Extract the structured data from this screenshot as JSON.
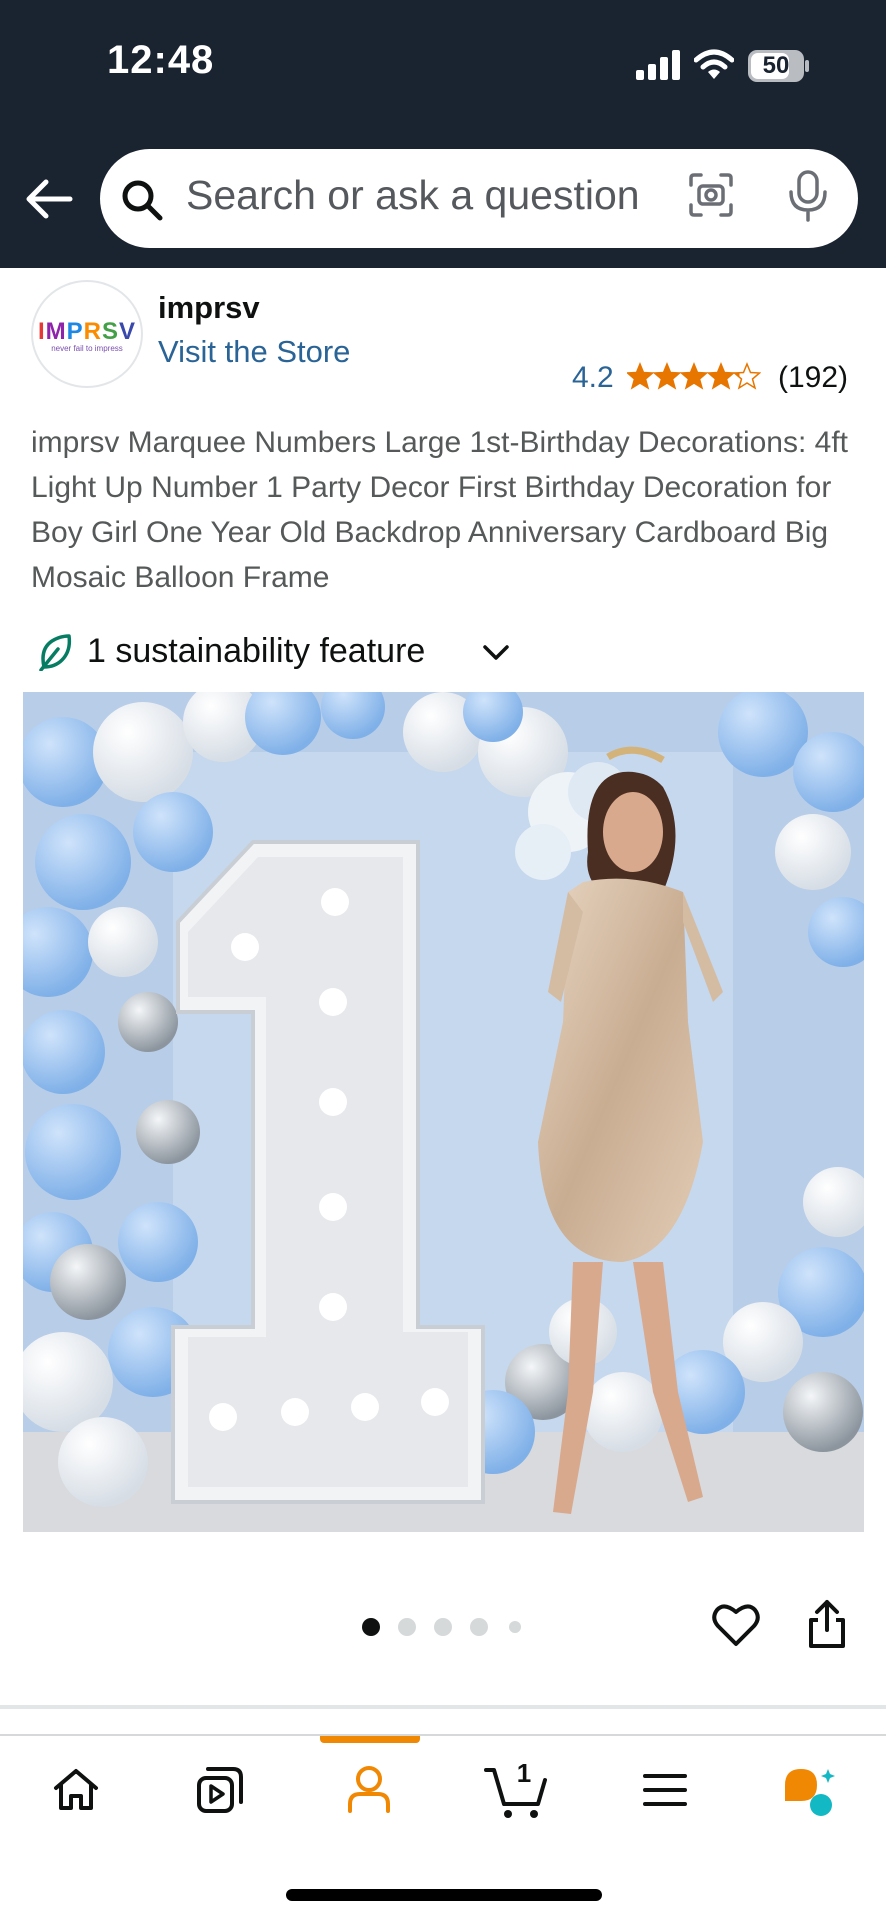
{
  "status_bar": {
    "time": "12:48",
    "battery": "50"
  },
  "search": {
    "placeholder": "Search or ask a question"
  },
  "brand": {
    "logo_text": "IMPRSV",
    "logo_tagline": "never fail to impress",
    "name": "imprsv",
    "visit_store": "Visit the Store"
  },
  "rating": {
    "value": "4.2",
    "count": "(192)",
    "stars_fraction": 0.84
  },
  "product": {
    "title": "imprsv Marquee Numbers Large 1st-Birthday Decorations: 4ft Light Up Number 1 Party Decor First Birthday Decoration for Boy Girl One Year Old Backdrop Anniversary Cardboard Big Mosaic Balloon Frame",
    "marquee_number": "1"
  },
  "sustainability": {
    "label": "1 sustainability feature"
  },
  "carousel": {
    "total": 5,
    "active_index": 0
  },
  "nav": {
    "items": [
      "home",
      "video",
      "account",
      "cart",
      "menu",
      "rufus"
    ],
    "active": "account",
    "cart_count": "1"
  },
  "colors": {
    "header_bg": "#1a2330",
    "link": "#2a6496",
    "star": "#e77600",
    "accent": "#f08804",
    "leaf": "#067d62"
  }
}
